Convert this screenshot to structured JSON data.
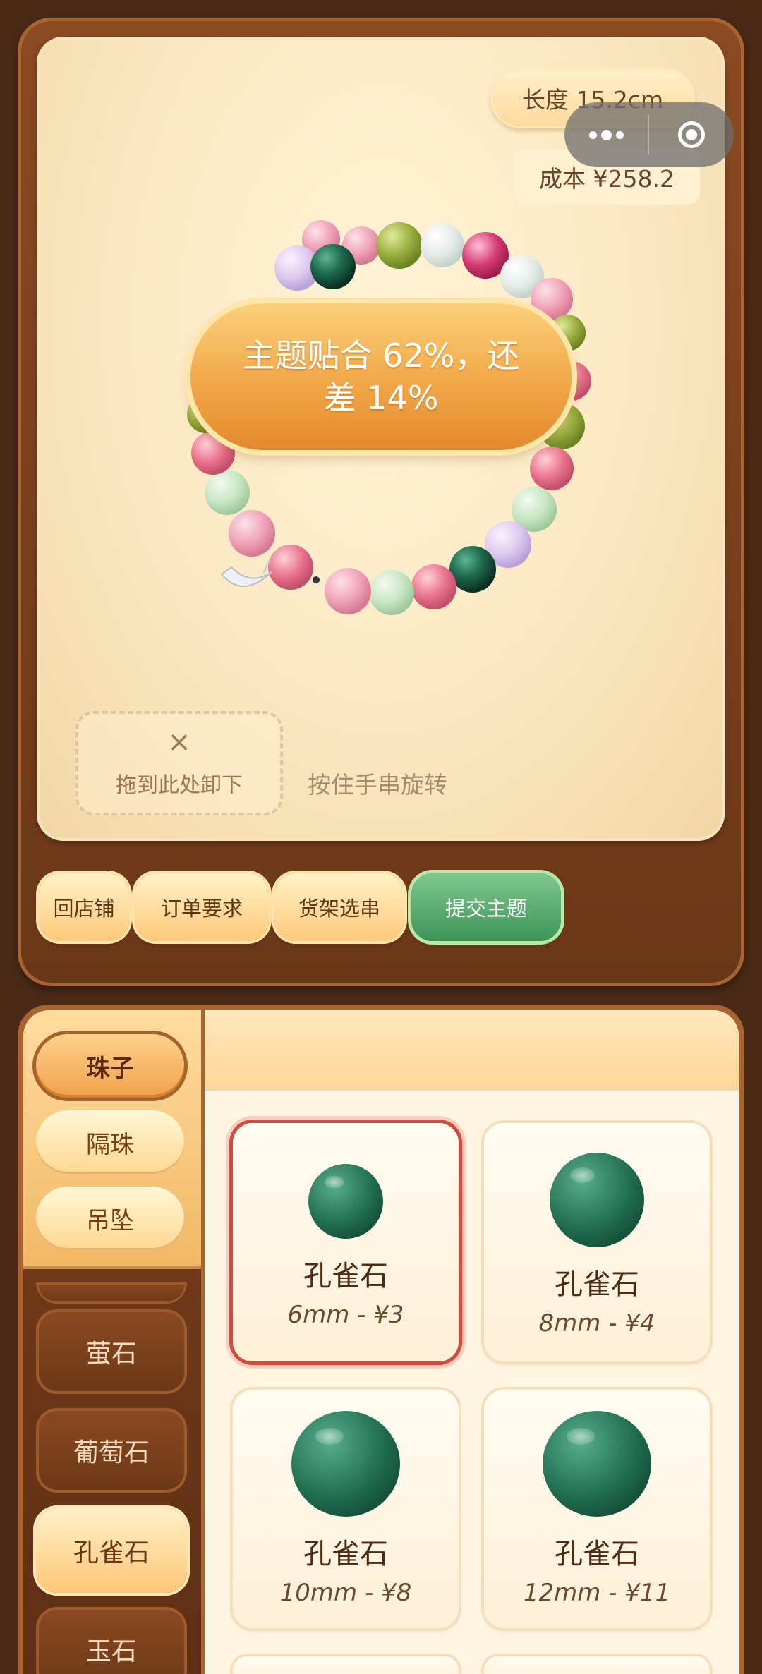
{
  "capsule": {
    "menu_icon": "more-dots-icon",
    "close_icon": "target-circle-icon"
  },
  "stats": {
    "length": "长度 15.2cm",
    "cost": "成本 ¥258.2"
  },
  "theme_banner": "主题贴合 62%，还差 14%",
  "drop_zone": {
    "icon": "×",
    "label": "拖到此处卸下"
  },
  "rotate_hint": "按住手串旋转",
  "actions": {
    "back_shop": "回店铺",
    "order_req": "订单要求",
    "shelf_pick": "货架选串",
    "submit_theme": "提交主题"
  },
  "tabs": [
    "珠子",
    "隔珠",
    "吊坠"
  ],
  "categories": [
    "萤石",
    "葡萄石",
    "孔雀石",
    "玉石"
  ],
  "active_category": "孔雀石",
  "products": [
    {
      "name": "孔雀石",
      "spec": "6mm - ¥3",
      "selected": true
    },
    {
      "name": "孔雀石",
      "spec": "8mm - ¥4",
      "selected": false
    },
    {
      "name": "孔雀石",
      "spec": "10mm - ¥8",
      "selected": false
    },
    {
      "name": "孔雀石",
      "spec": "12mm - ¥11",
      "selected": false
    }
  ],
  "colors": {
    "submit_green": "#4f9f62",
    "selected_border": "#d44b3e",
    "malachite": "#1f6b4e"
  }
}
